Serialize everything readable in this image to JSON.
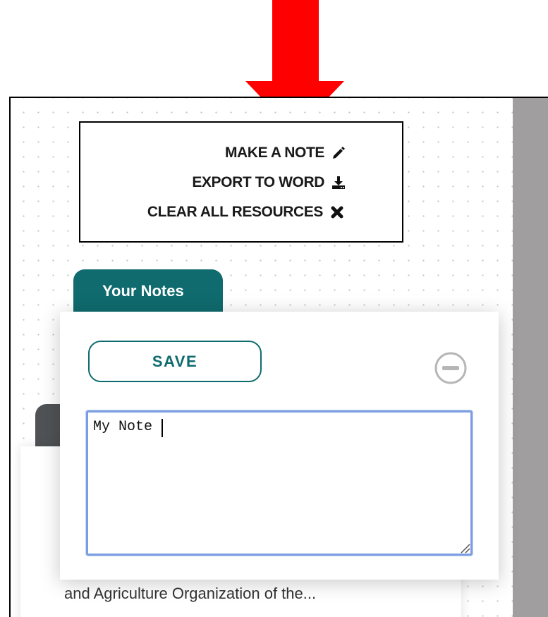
{
  "actions": {
    "make_note": "MAKE A NOTE",
    "export_word": "EXPORT TO WORD",
    "clear_all": "CLEAR ALL RESOURCES"
  },
  "icons": {
    "make_note": "pencil-icon",
    "export_word": "download-icon",
    "clear_all": "close-icon",
    "collapse": "minus-circle-icon",
    "annotation": "red-arrow-down"
  },
  "tab": {
    "label": "Your Notes"
  },
  "note_editor": {
    "save_label": "SAVE",
    "value": "My Note"
  },
  "underlying_card": {
    "text": "and Agriculture Organization of the..."
  },
  "colors": {
    "accent": "#0f6b6e",
    "annotation_arrow": "#ff0000",
    "textarea_focus": "#7b9ee3",
    "side_panel": "#a09e9f"
  }
}
